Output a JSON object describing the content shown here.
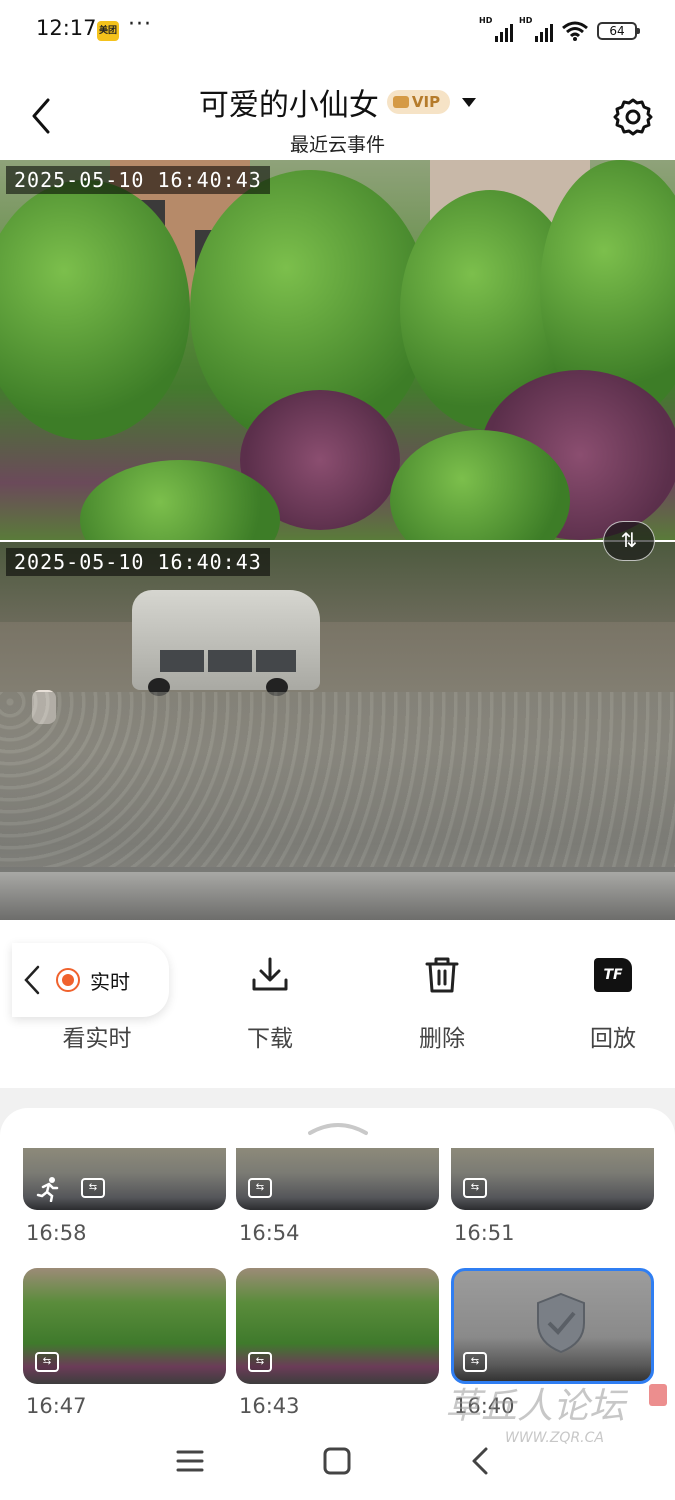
{
  "status_bar": {
    "time": "12:17",
    "app_badge": "美团",
    "more": "···",
    "signal_1_label": "HD",
    "signal_2_label": "HD",
    "battery": "64"
  },
  "header": {
    "title": "可爱的小仙女",
    "vip_label": "VIP",
    "subtitle": "最近云事件"
  },
  "feeds": {
    "top_timestamp": "2025-05-10  16:40:43",
    "bottom_timestamp": "2025-05-10  16:40:43"
  },
  "toolbar": {
    "live_pill_label": "实时",
    "watch_live_label": "看实时",
    "download_label": "下载",
    "delete_label": "删除",
    "playback_label": "回放",
    "tf_label": "TF"
  },
  "events": [
    {
      "time": "16:58"
    },
    {
      "time": "16:54"
    },
    {
      "time": "16:51"
    },
    {
      "time": "16:47"
    },
    {
      "time": "16:43"
    },
    {
      "time": "16:40"
    }
  ],
  "colors": {
    "accent_orange": "#f0622d",
    "selected_blue": "#2f7ef2",
    "vip_gold": "#b57b2b"
  },
  "watermark": {
    "text": "草丘人论坛",
    "url": "WWW.ZQR.CA"
  }
}
